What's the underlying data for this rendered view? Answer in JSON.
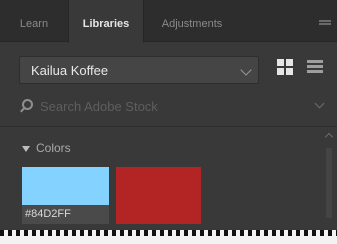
{
  "tabs": [
    {
      "label": "Learn"
    },
    {
      "label": "Libraries"
    },
    {
      "label": "Adjustments"
    }
  ],
  "library": {
    "selected": "Kailua Koffee"
  },
  "search": {
    "placeholder": "Search Adobe Stock"
  },
  "section": {
    "title": "Colors"
  },
  "colors": [
    {
      "hex_label": "#84D2FF",
      "color": "#84D2FF"
    },
    {
      "color": "#B32424"
    }
  ],
  "icons": {
    "grid_view": "grid-view-icon",
    "list_view": "list-view-icon",
    "search": "search-icon",
    "panel_menu": "panel-menu-icon"
  }
}
